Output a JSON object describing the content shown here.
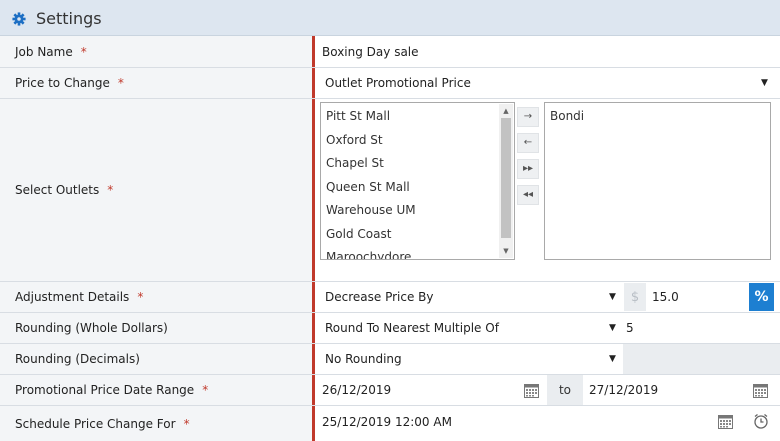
{
  "header": {
    "title": "Settings"
  },
  "fields": {
    "job_name": {
      "label": "Job Name",
      "required": "*",
      "value": "Boxing Day sale"
    },
    "price_to_change": {
      "label": "Price to Change",
      "required": "*",
      "value": "Outlet Promotional Price"
    },
    "select_outlets": {
      "label": "Select Outlets",
      "required": "*",
      "available": [
        "Pitt St Mall",
        "Oxford St",
        "Chapel St",
        "Queen St Mall",
        "Warehouse UM",
        "Gold Coast",
        "Maroochydore"
      ],
      "selected": [
        "Bondi"
      ],
      "buttons": {
        "move_right": "→",
        "move_left": "←",
        "move_all_right": "▸▸",
        "move_all_left": "◂◂"
      }
    },
    "adjustment_details": {
      "label": "Adjustment Details",
      "required": "*",
      "mode": "Decrease Price By",
      "currency_symbol": "$",
      "amount": "15.0",
      "percent_symbol": "%"
    },
    "rounding_whole": {
      "label": "Rounding (Whole Dollars)",
      "mode": "Round To Nearest Multiple Of",
      "multiple": "5"
    },
    "rounding_decimals": {
      "label": "Rounding (Decimals)",
      "mode": "No Rounding"
    },
    "date_range": {
      "label": "Promotional Price Date Range",
      "required": "*",
      "from": "26/12/2019",
      "to_label": "to",
      "to": "27/12/2019"
    },
    "schedule": {
      "label": "Schedule Price Change For",
      "required": "*",
      "value": "25/12/2019 12:00 AM"
    }
  },
  "colors": {
    "required_marker": "#c0392b",
    "accent_button": "#1d7fd1",
    "header_bg": "#dde6f0"
  },
  "icons": {
    "header": "gear-icon",
    "date": "calendar-icon",
    "time": "clock-icon"
  }
}
